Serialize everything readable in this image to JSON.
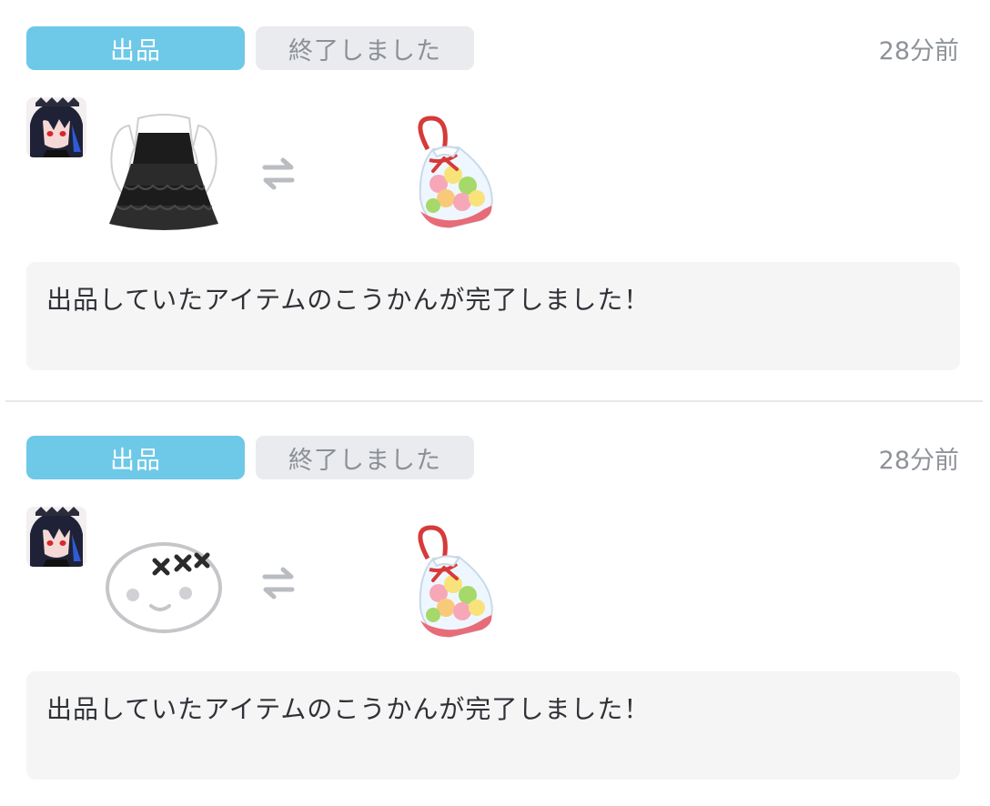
{
  "notifications": [
    {
      "type_label": "出品",
      "status_label": "終了しました",
      "time": "28分前",
      "given_item": "black-frill-dress-icon",
      "received_item": "candy-bag-icon",
      "message": "出品していたアイテムのこうかんが完了しました！"
    },
    {
      "type_label": "出品",
      "status_label": "終了しました",
      "time": "28分前",
      "given_item": "face-with-x-eyes-icon",
      "received_item": "candy-bag-icon",
      "message": "出品していたアイテムのこうかんが完了しました！"
    }
  ],
  "colors": {
    "type_badge_bg": "#6ec8e8",
    "status_badge_bg": "#e9ebee",
    "message_box_bg": "#f5f5f6",
    "timestamp_text": "#8e939a"
  }
}
